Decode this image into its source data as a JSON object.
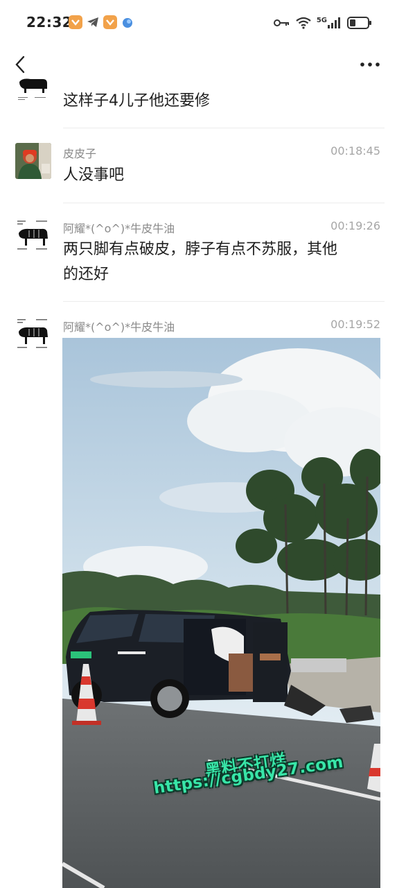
{
  "status_bar": {
    "time": "22:32",
    "network": "5G",
    "icons": [
      "notification-icon",
      "telegram-icon",
      "notification-icon",
      "app-icon",
      "key-icon",
      "wifi-icon",
      "signal-icon",
      "battery-icon"
    ]
  },
  "nav": {
    "back_icon": "chevron-left-icon",
    "more_icon": "more-icon"
  },
  "messages": [
    {
      "name": "",
      "time": "",
      "text": "这样子4儿子他还要修"
    },
    {
      "name": "皮皮子",
      "time": "00:18:45",
      "text": "人没事吧"
    },
    {
      "name": "阿耀*(^o^)*牛皮牛油",
      "time": "00:19:26",
      "text_line1": "两只脚有点破皮，脖子有点不苏服，其他",
      "text_line2": "的还好"
    },
    {
      "name": "阿耀*(^o^)*牛皮牛油",
      "time": "00:19:52",
      "image": "car-accident-photo"
    }
  ],
  "watermark": {
    "line1": "黑料不打烊",
    "line2": "https://cgbdy27.com"
  },
  "colors": {
    "accent": "#38e6a8",
    "timestamp": "#a6a6a6",
    "name": "#8a8a8a"
  }
}
